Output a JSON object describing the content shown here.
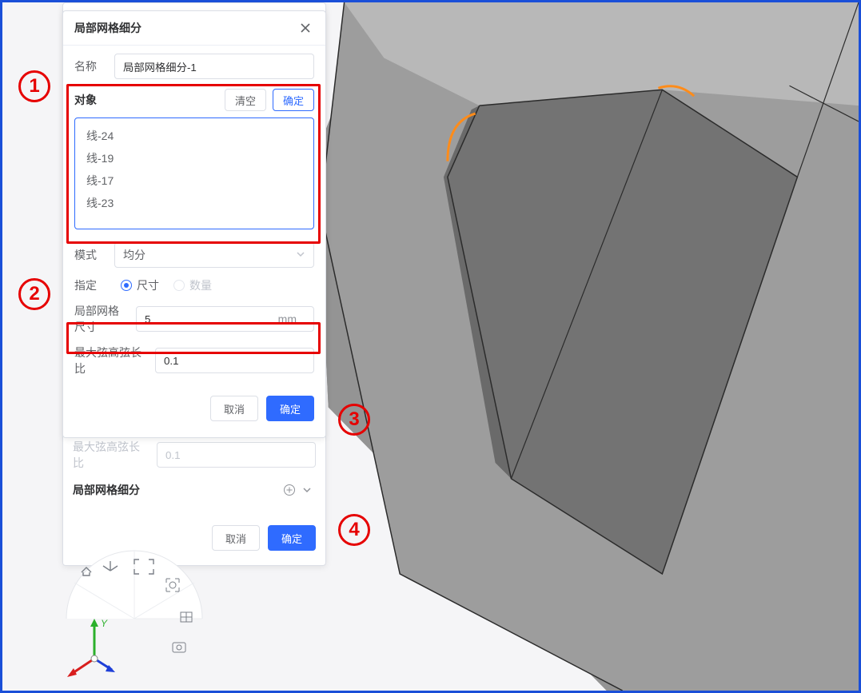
{
  "panel_title": "局部网格细分",
  "name_label": "名称",
  "name_value": "局部网格细分-1",
  "objects": {
    "label": "对象",
    "clear": "清空",
    "confirm": "确定",
    "items": [
      "线-24",
      "线-19",
      "线-17",
      "线-23"
    ]
  },
  "mode": {
    "label": "模式",
    "value": "均分"
  },
  "specify": {
    "label": "指定",
    "opt_size": "尺寸",
    "opt_count": "数量",
    "checked": "size"
  },
  "local_size": {
    "label": "局部网格尺寸",
    "value": "5",
    "unit": "mm"
  },
  "chord": {
    "label": "最大弦高弦长比",
    "value": "0.1"
  },
  "footer": {
    "cancel": "取消",
    "ok": "确定"
  },
  "back_panel": {
    "chord_label": "最大弦高弦长比",
    "chord_value": "0.1",
    "section_title": "局部网格细分",
    "cancel": "取消",
    "ok": "确定"
  },
  "annotations": {
    "a1": "1",
    "a2": "2",
    "a3": "3",
    "a4": "4"
  },
  "axes": {
    "y": "Y"
  }
}
